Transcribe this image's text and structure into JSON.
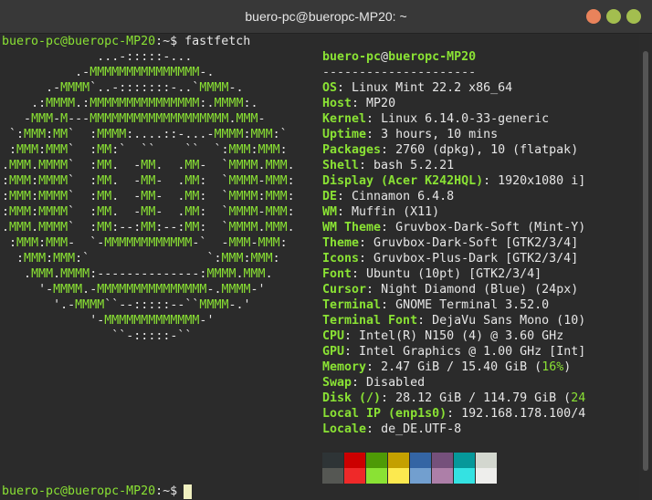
{
  "window": {
    "title": "buero-pc@bueropc-MP20: ~"
  },
  "prompt": {
    "user_host": "buero-pc@bueropc-MP20",
    "path": ":~",
    "symbol": "$",
    "command": " fastfetch"
  },
  "logo_lines": [
    "             ...-:::::-...",
    "          .-MMMMMMMMMMMMMMM-.",
    "      .-MMMM`..-:::::::-..`MMMM-.",
    "    .:MMMM.:MMMMMMMMMMMMMMM:.MMMM:.",
    "   -MMM-M---MMMMMMMMMMMMMMMMMMM.MMM-",
    " `:MMM:MM`  :MMMM:....::-...-MMMM:MMM:`",
    " :MMM:MMM`  :MM:`  ``    ``  `:MMM:MMM:",
    ".MMM.MMMM`  :MM.  -MM.  .MM-  `MMMM.MMM.",
    ":MMM:MMMM`  :MM.  -MM-  .MM:  `MMMM-MMM:",
    ":MMM:MMMM`  :MM.  -MM-  .MM:  `MMMM:MMM:",
    ":MMM:MMMM`  :MM.  -MM-  .MM:  `MMMM-MMM:",
    ".MMM.MMMM`  :MM:--:MM:--:MM:  `MMMM.MMM.",
    " :MMM:MMM-  `-MMMMMMMMMMMM-`  -MMM-MMM:",
    "  :MMM:MMM:`                `:MMM:MMM:",
    "   .MMM.MMMM:--------------:MMMM.MMM.",
    "     '-MMMM.-MMMMMMMMMMMMMMM-.MMMM-'",
    "       '.-MMMM``--:::::--``MMMM-.'",
    "            '-MMMMMMMMMMMMM-'",
    "               ``-:::::-``"
  ],
  "info": {
    "header_user": "buero-pc",
    "header_at": "@",
    "header_host": "bueropc-MP20",
    "separator": "---------------------",
    "rows": [
      {
        "key": "OS",
        "value": "Linux Mint 22.2 x86_64"
      },
      {
        "key": "Host",
        "value": "MP20"
      },
      {
        "key": "Kernel",
        "value": "Linux 6.14.0-33-generic"
      },
      {
        "key": "Uptime",
        "value": "3 hours, 10 mins"
      },
      {
        "key": "Packages",
        "value": "2760 (dpkg), 10 (flatpak)"
      },
      {
        "key": "Shell",
        "value": "bash 5.2.21"
      },
      {
        "key": "Display (Acer K242HQL)",
        "value": "1920x1080 i]"
      },
      {
        "key": "DE",
        "value": "Cinnamon 6.4.8"
      },
      {
        "key": "WM",
        "value": "Muffin (X11)"
      },
      {
        "key": "WM Theme",
        "value": "Gruvbox-Dark-Soft (Mint-Y)"
      },
      {
        "key": "Theme",
        "value": "Gruvbox-Dark-Soft [GTK2/3/4]"
      },
      {
        "key": "Icons",
        "value": "Gruvbox-Plus-Dark [GTK2/3/4]"
      },
      {
        "key": "Font",
        "value": "Ubuntu (10pt) [GTK2/3/4]"
      },
      {
        "key": "Cursor",
        "value": "Night Diamond (Blue) (24px)"
      },
      {
        "key": "Terminal",
        "value": "GNOME Terminal 3.52.0"
      },
      {
        "key": "Terminal Font",
        "value": "DejaVu Sans Mono (10)"
      },
      {
        "key": "CPU",
        "value": "Intel(R) N150 (4) @ 3.60 GHz"
      },
      {
        "key": "GPU",
        "value": "Intel Graphics @ 1.00 GHz [Int]"
      },
      {
        "key": "Memory",
        "value": "2.47 GiB / 15.40 GiB (",
        "value_hl": "16%",
        "value_tail": ")"
      },
      {
        "key": "Swap",
        "value": "Disabled"
      },
      {
        "key": "Disk (/)",
        "value": "28.12 GiB / 114.79 GiB (",
        "value_hl": "24",
        "value_tail": ""
      },
      {
        "key": "Local IP (enp1s0)",
        "value": "192.168.178.100/4"
      },
      {
        "key": "Locale",
        "value": "de_DE.UTF-8"
      }
    ],
    "key_sep": ": "
  },
  "palette": {
    "row1": [
      "#2e3436",
      "#cc0000",
      "#4e9a06",
      "#c4a000",
      "#3465a4",
      "#75507b",
      "#06989a",
      "#d3d7cf"
    ],
    "row2": [
      "#555753",
      "#ef2929",
      "#8ae234",
      "#fce94f",
      "#729fcf",
      "#ad7fa8",
      "#34e2e2",
      "#eeeeec"
    ]
  },
  "colors": {
    "accent_green": "#8ae234",
    "background": "#2b2b2b"
  }
}
